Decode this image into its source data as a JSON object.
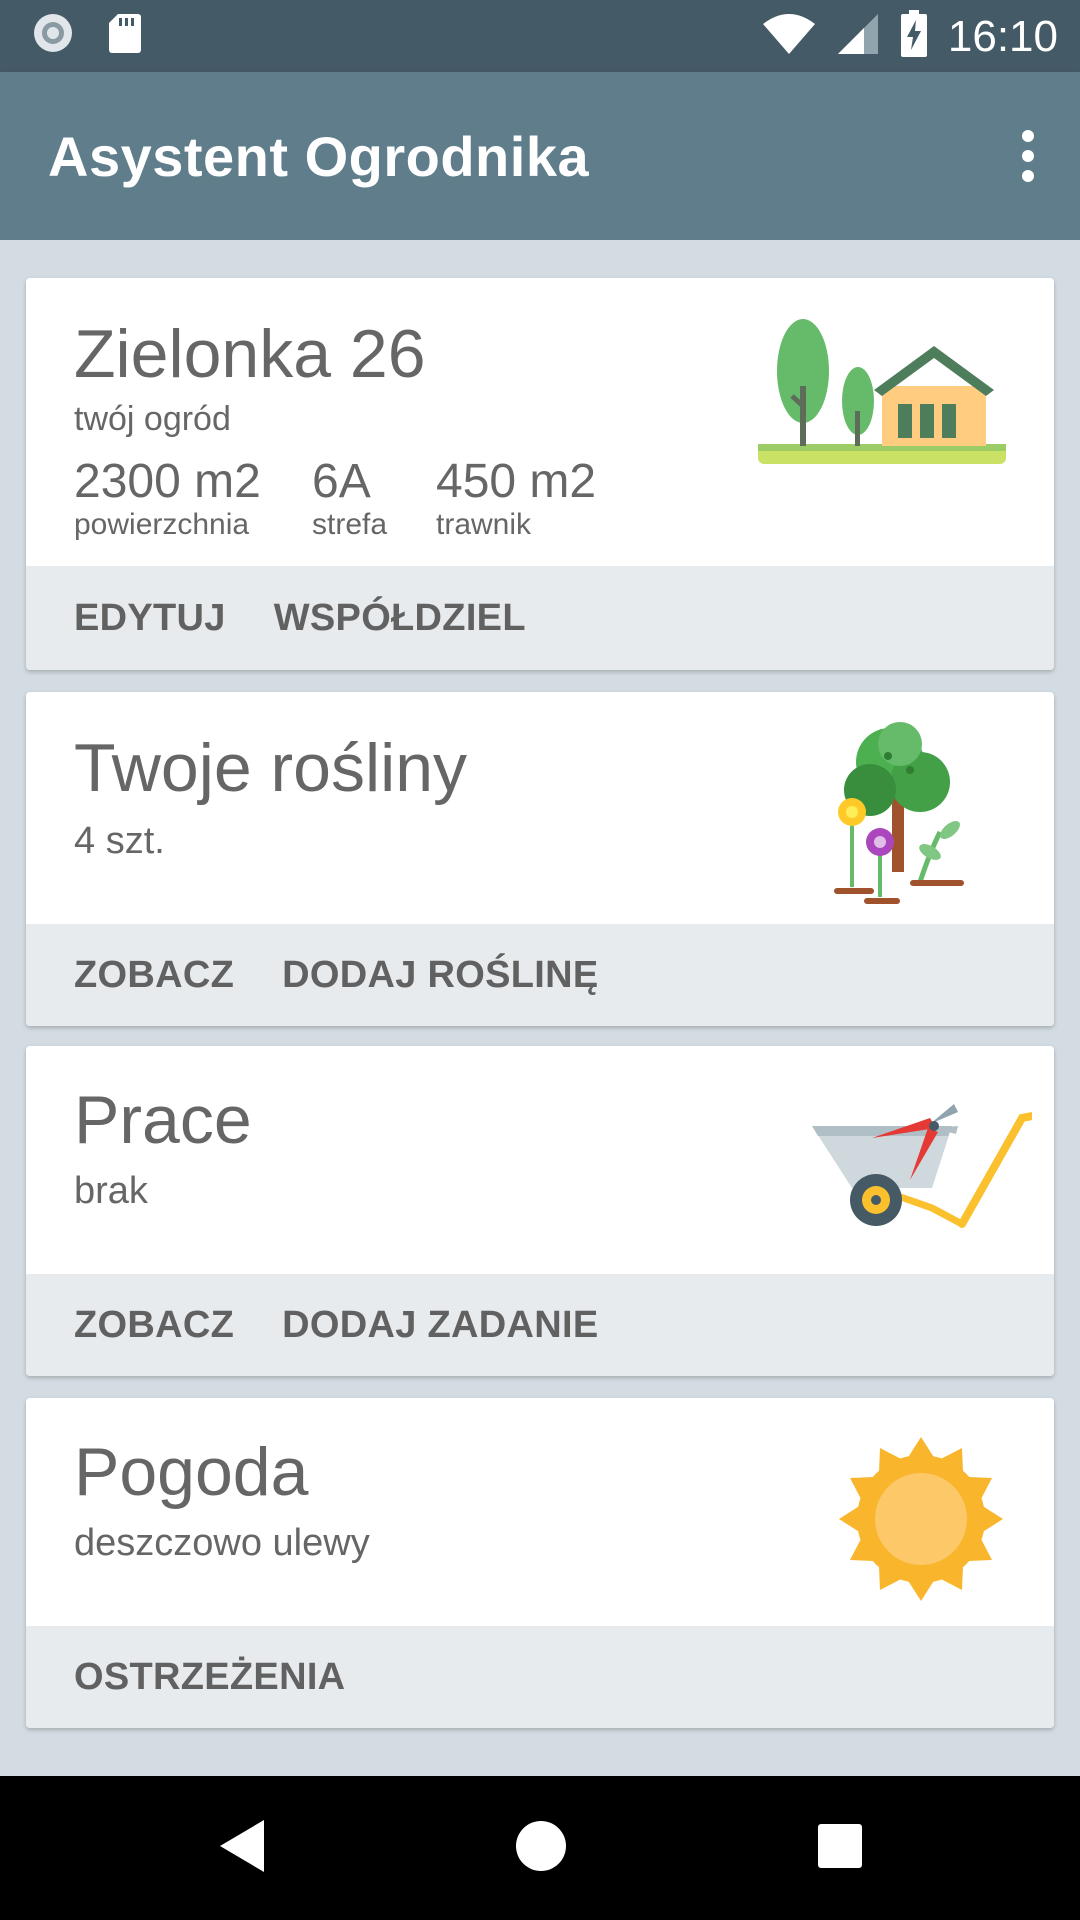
{
  "status_bar": {
    "time": "16:10",
    "icons": [
      "record-icon",
      "sd-card-icon",
      "wifi-icon",
      "signal-icon",
      "battery-charging-icon"
    ]
  },
  "app_bar": {
    "title": "Asystent Ogrodnika",
    "menu_icon": "overflow-menu-icon"
  },
  "cards": {
    "garden": {
      "title": "Zielonka 26",
      "subtitle": "twój ogród",
      "stats": [
        {
          "value": "2300 m2",
          "label": "powierzchnia"
        },
        {
          "value": "6A",
          "label": "strefa"
        },
        {
          "value": "450 m2",
          "label": "trawnik"
        }
      ],
      "actions": [
        "EDYTUJ",
        "WSPÓŁDZIEL"
      ],
      "icon": "house-garden-icon"
    },
    "plants": {
      "title": "Twoje rośliny",
      "subtitle": "4 szt.",
      "actions": [
        "ZOBACZ",
        "DODAJ ROŚLINĘ"
      ],
      "icon": "tree-flowers-icon"
    },
    "tasks": {
      "title": "Prace",
      "subtitle": "brak",
      "actions": [
        "ZOBACZ",
        "DODAJ ZADANIE"
      ],
      "icon": "wheelbarrow-shears-icon"
    },
    "weather": {
      "title": "Pogoda",
      "subtitle": "deszczowo ulewy",
      "actions": [
        "OSTRZEŻENIA"
      ],
      "icon": "sun-icon"
    }
  },
  "colors": {
    "status_bar": "#455a67",
    "app_bar": "#607d8b",
    "background": "#d3dce2",
    "action_strip": "#e7ebee",
    "text": "#666666"
  },
  "nav_bar": {
    "icons": [
      "back-icon",
      "home-icon",
      "recents-icon"
    ]
  }
}
